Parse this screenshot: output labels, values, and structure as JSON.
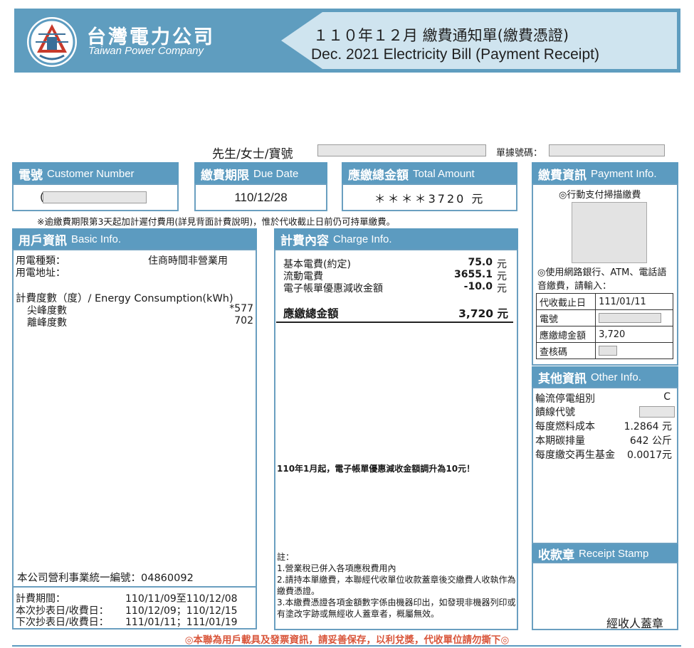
{
  "header": {
    "company_cn": "台灣電力公司",
    "company_en": "Taiwan Power Company",
    "title_cn": "１１０年１２月 繳費通知單(繳費憑證)",
    "title_en": "Dec. 2021 Electricity Bill (Payment Receipt)"
  },
  "recipient": {
    "salutation": "先生/女士/寶號",
    "receipt_no_label": "單據號碼："
  },
  "customer_number": {
    "label_cn": "電號",
    "label_en": "Customer Number",
    "left_mark": "("
  },
  "due_date": {
    "label_cn": "繳費期限",
    "label_en": "Due Date",
    "value": "110/12/28"
  },
  "total_amount": {
    "label_cn": "應繳總金額",
    "label_en": "Total Amount",
    "value": "＊＊＊＊3720 元"
  },
  "notice": "※逾繳費期限第3天起加計遲付費用(詳見背面計費說明)，惟於代收截止日前仍可持單繳費。",
  "basic_info": {
    "label_cn": "用戶資訊",
    "label_en": "Basic Info.",
    "usage_type_label": "用電種類：",
    "usage_type_value": "住商時間非營業用",
    "address_label": "用電地址：",
    "consumption_label": "計費度數（度）/ Energy Consumption(kWh)",
    "peak_label": "尖峰度數",
    "peak_value": "*577",
    "offpeak_label": "離峰度數",
    "offpeak_value": "702",
    "tax_id": "本公司營利事業統一編號：04860092",
    "period_label": "計費期間：",
    "period_value": "110/11/09至110/12/08",
    "this_read_label": "本次抄表日/收費日：",
    "this_read_value": "110/12/09；110/12/15",
    "next_read_label": "下次抄表日/收費日：",
    "next_read_value": "111/01/11；111/01/19"
  },
  "charge_info": {
    "label_cn": "計費內容",
    "label_en": "Charge Info.",
    "items": [
      {
        "label": "基本電費(約定)",
        "value": "75.0",
        "unit": "元"
      },
      {
        "label": "流動電費",
        "value": "3655.1",
        "unit": "元"
      },
      {
        "label": "電子帳單優惠減收金額",
        "value": "-10.0",
        "unit": "元"
      }
    ],
    "total_label": "應繳總金額",
    "total_value": "3,720 元",
    "announcement": "110年1月起，電子帳單優惠減收金額調升為10元！",
    "note_title": "註：",
    "note1": "1.營業稅已併入各項應稅費用內",
    "note2": "2.請持本單繳費，本聯經代收單位收款蓋章後交繳費人收執作為繳費憑證。",
    "note3": "3.本繳費憑證各項金額數字係由機器印出，如發現非機器列印或有塗改字跡或無經收人蓋章者，概屬無效。"
  },
  "payment_info": {
    "label_cn": "繳費資訊",
    "label_en": "Payment Info.",
    "mobile_pay": "◎行動支付掃描繳費",
    "online_pay": "◎使用網路銀行、ATM、電話語音繳費，請輸入：",
    "rows": [
      {
        "label": "代收截止日",
        "value": "111/01/11"
      },
      {
        "label": "電號",
        "value": ""
      },
      {
        "label": "應繳總金額",
        "value": "3,720"
      },
      {
        "label": "查核碼",
        "value": ""
      }
    ]
  },
  "other_info": {
    "label_cn": "其他資訊",
    "label_en": "Other Info.",
    "rows": [
      {
        "label": "輪流停電組別",
        "value": "C"
      },
      {
        "label": "饋線代號",
        "value": ""
      },
      {
        "label": "每度燃料成本",
        "value": "1.2864 元"
      },
      {
        "label": "本期碳排量",
        "value": "642 公斤"
      },
      {
        "label": "每度繳交再生基金",
        "value": "0.0017元"
      }
    ]
  },
  "stamp": {
    "label_cn": "收款章",
    "label_en": "Receipt Stamp",
    "collector": "經收人蓋章"
  },
  "footer": "◎本聯為用戶載具及發票資訊，請妥善保存，以利兌獎，代收單位請勿撕下◎",
  "colors": {
    "header_blue": "#5c9bc0",
    "banner_light": "#cfe4ef",
    "footer_red": "#d9553a"
  }
}
